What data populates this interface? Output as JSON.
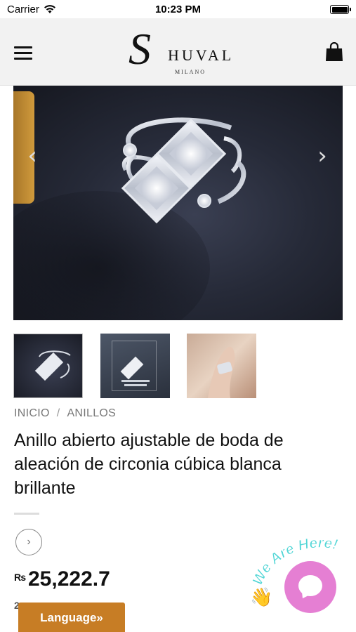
{
  "status_bar": {
    "carrier": "Carrier",
    "time": "10:23 PM"
  },
  "header": {
    "logo_initial": "S",
    "logo_word": "HUVAL",
    "logo_sub": "MILANO",
    "menu_icon": "hamburger-menu-icon",
    "cart_icon": "shopping-bag-icon"
  },
  "gallery": {
    "prev_arrow": "‹",
    "next_arrow": "›",
    "thumbnail_count": 3
  },
  "breadcrumb": {
    "home": "INICIO",
    "separator": "/",
    "category": "ANILLOS"
  },
  "product": {
    "title": "Anillo abierto ajustable de boda de aleación de circonia cúbica blanca brillante",
    "currency": "₨",
    "price": "25,222.7",
    "partial_line": "2"
  },
  "circle_button": {
    "icon": "chevron-right-icon",
    "glyph": "›"
  },
  "language_button": {
    "label": "Language»"
  },
  "chat_widget": {
    "text": "We Are Here!",
    "accent_color": "#e57fd3",
    "text_color": "#52d6d6",
    "wave_icon": "waving-hand-icon"
  },
  "colors": {
    "language_button_bg": "#c77d25",
    "header_bg": "#f2f2f2"
  }
}
